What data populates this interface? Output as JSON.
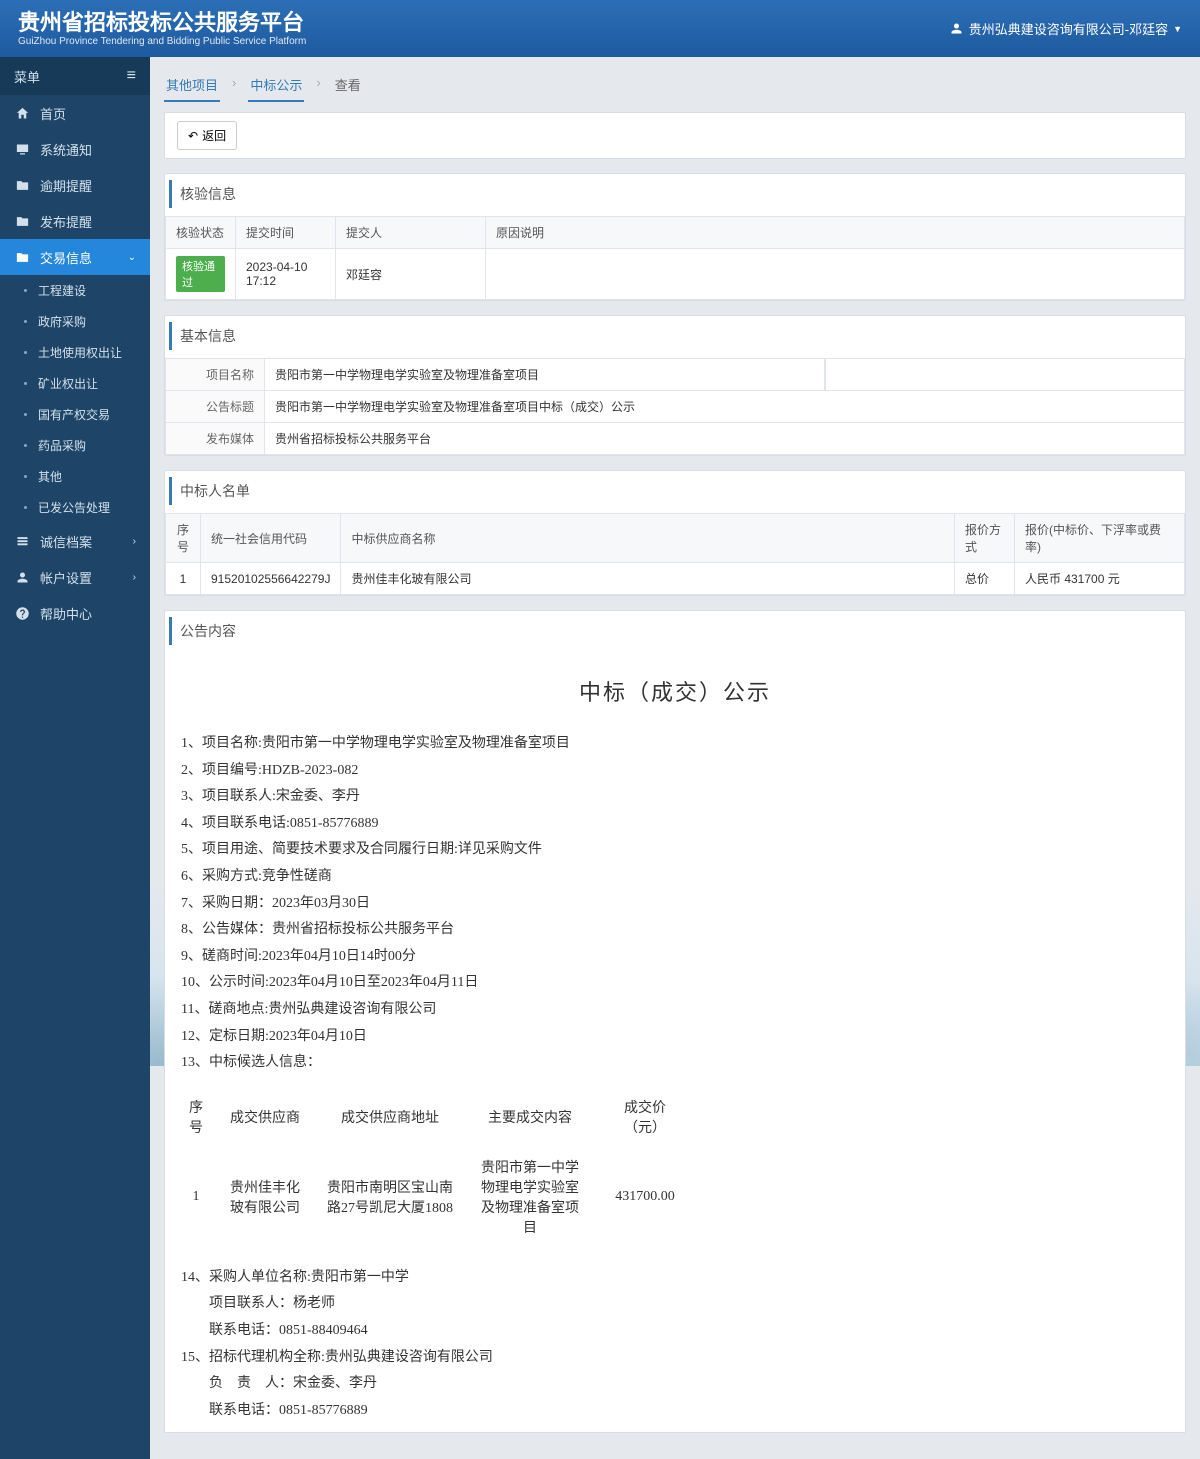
{
  "header": {
    "title": "贵州省招标投标公共服务平台",
    "subtitle": "GuiZhou Province Tendering and Bidding Public Service Platform",
    "user": "贵州弘典建设咨询有限公司-邓廷容"
  },
  "sidebar": {
    "menu_label": "菜单",
    "items": [
      {
        "icon": "home",
        "label": "首页"
      },
      {
        "icon": "monitor",
        "label": "系统通知"
      },
      {
        "icon": "folder",
        "label": "逾期提醒"
      },
      {
        "icon": "folder",
        "label": "发布提醒"
      },
      {
        "icon": "folder",
        "label": "交易信息",
        "active": true,
        "expanded": true
      }
    ],
    "subitems": [
      "工程建设",
      "政府采购",
      "土地使用权出让",
      "矿业权出让",
      "国有产权交易",
      "药品采购",
      "其他",
      "已发公告处理"
    ],
    "tail": [
      {
        "icon": "list",
        "label": "诚信档案",
        "chev": true
      },
      {
        "icon": "user",
        "label": "帐户设置",
        "chev": true
      },
      {
        "icon": "help",
        "label": "帮助中心"
      }
    ]
  },
  "breadcrumb": [
    "其他项目",
    "中标公示",
    "查看"
  ],
  "back_label": "返回",
  "verify": {
    "section": "核验信息",
    "headers": [
      "核验状态",
      "提交时间",
      "提交人",
      "原因说明"
    ],
    "row": {
      "status": "核验通过",
      "time": "2023-04-10 17:12",
      "submitter": "邓廷容",
      "reason": ""
    }
  },
  "basic": {
    "section": "基本信息",
    "rows": [
      {
        "label": "项目名称",
        "value": "贵阳市第一中学物理电学实验室及物理准备室项目"
      },
      {
        "label": "公告标题",
        "value": "贵阳市第一中学物理电学实验室及物理准备室项目中标（成交）公示"
      },
      {
        "label": "发布媒体",
        "value": "贵州省招标投标公共服务平台"
      }
    ]
  },
  "winners": {
    "section": "中标人名单",
    "headers": [
      "序号",
      "统一社会信用代码",
      "中标供应商名称",
      "报价方式",
      "报价(中标价、下浮率或费率)"
    ],
    "rows": [
      {
        "no": "1",
        "code": "91520102556642279J",
        "name": "贵州佳丰化玻有限公司",
        "method": "总价",
        "price": "人民币 431700 元"
      }
    ]
  },
  "notice": {
    "section": "公告内容",
    "title": "中标（成交）公示",
    "lines": [
      "1、项目名称:贵阳市第一中学物理电学实验室及物理准备室项目",
      "2、项目编号:HDZB-2023-082",
      "3、项目联系人:宋金委、李丹",
      "4、项目联系电话:0851-85776889",
      "5、项目用途、简要技术要求及合同履行日期:详见采购文件",
      "6、采购方式:竞争性磋商",
      "7、采购日期：2023年03月30日",
      "8、公告媒体：贵州省招标投标公共服务平台",
      "9、磋商时间:2023年04月10日14时00分",
      "10、公示时间:2023年04月10日至2023年04月11日",
      "11、磋商地点:贵州弘典建设咨询有限公司",
      "12、定标日期:2023年04月10日",
      "13、中标候选人信息："
    ],
    "table": {
      "headers": [
        "序号",
        "成交供应商",
        "成交供应商地址",
        "主要成交内容",
        "成交价（元）"
      ],
      "row": {
        "no": "1",
        "supplier": "贵州佳丰化玻有限公司",
        "addr": "贵阳市南明区宝山南路27号凯尼大厦1808",
        "content": "贵阳市第一中学物理电学实验室及物理准备室项目",
        "price": "431700.00"
      }
    },
    "tail": [
      "14、采购人单位名称:贵阳市第一中学",
      "项目联系人：杨老师",
      "联系电话：0851-88409464",
      "15、招标代理机构全称:贵州弘典建设咨询有限公司",
      "负　责　人：宋金委、李丹",
      "联系电话：0851-85776889"
    ]
  }
}
